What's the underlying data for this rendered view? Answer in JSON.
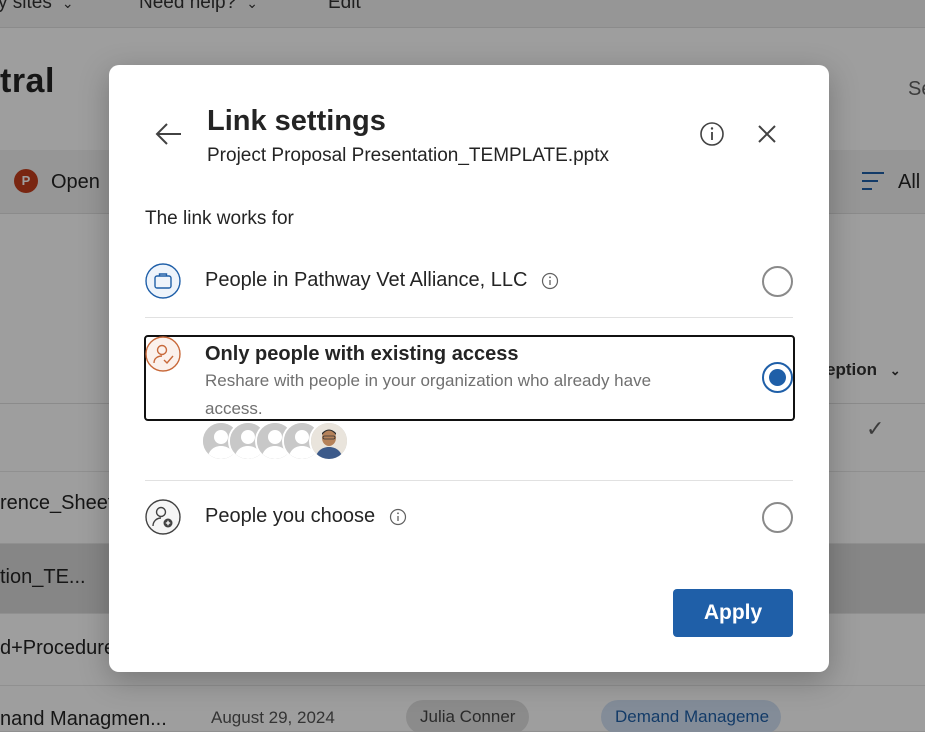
{
  "background": {
    "nav": {
      "item1": "y sites",
      "item2": "Need help?",
      "item3": "Edit"
    },
    "site_title": "tral",
    "search_stub": "Se",
    "command_bar": {
      "open": "Open",
      "ppt_badge": "P",
      "filter_label": "All"
    },
    "column_exception": "eption",
    "rows": [
      {
        "name": "rence_Sheet"
      },
      {
        "name": "tion_TE..."
      },
      {
        "name": "d+Procedure"
      },
      {
        "name": "nand Managmen...",
        "date": "August 29, 2024",
        "person": "Julia Conner",
        "tag": "Demand Manageme"
      }
    ]
  },
  "dialog": {
    "title": "Link settings",
    "subtitle": "Project Proposal Presentation_TEMPLATE.pptx",
    "section_label": "The link works for",
    "options": [
      {
        "label": "People in Pathway Vet Alliance, LLC",
        "icon": "briefcase-icon",
        "selected": false
      },
      {
        "label": "Only people with existing access",
        "description": "Reshare with people in your organization who already have access.",
        "icon": "person-check-icon",
        "selected": true
      },
      {
        "label": "People you choose",
        "icon": "person-add-icon",
        "selected": false
      }
    ],
    "avatar_count": 5,
    "apply_label": "Apply"
  },
  "colors": {
    "accent": "#1f5fa8",
    "opt2_icon": "#c8693a",
    "opt1_icon": "#1f5fa8"
  }
}
